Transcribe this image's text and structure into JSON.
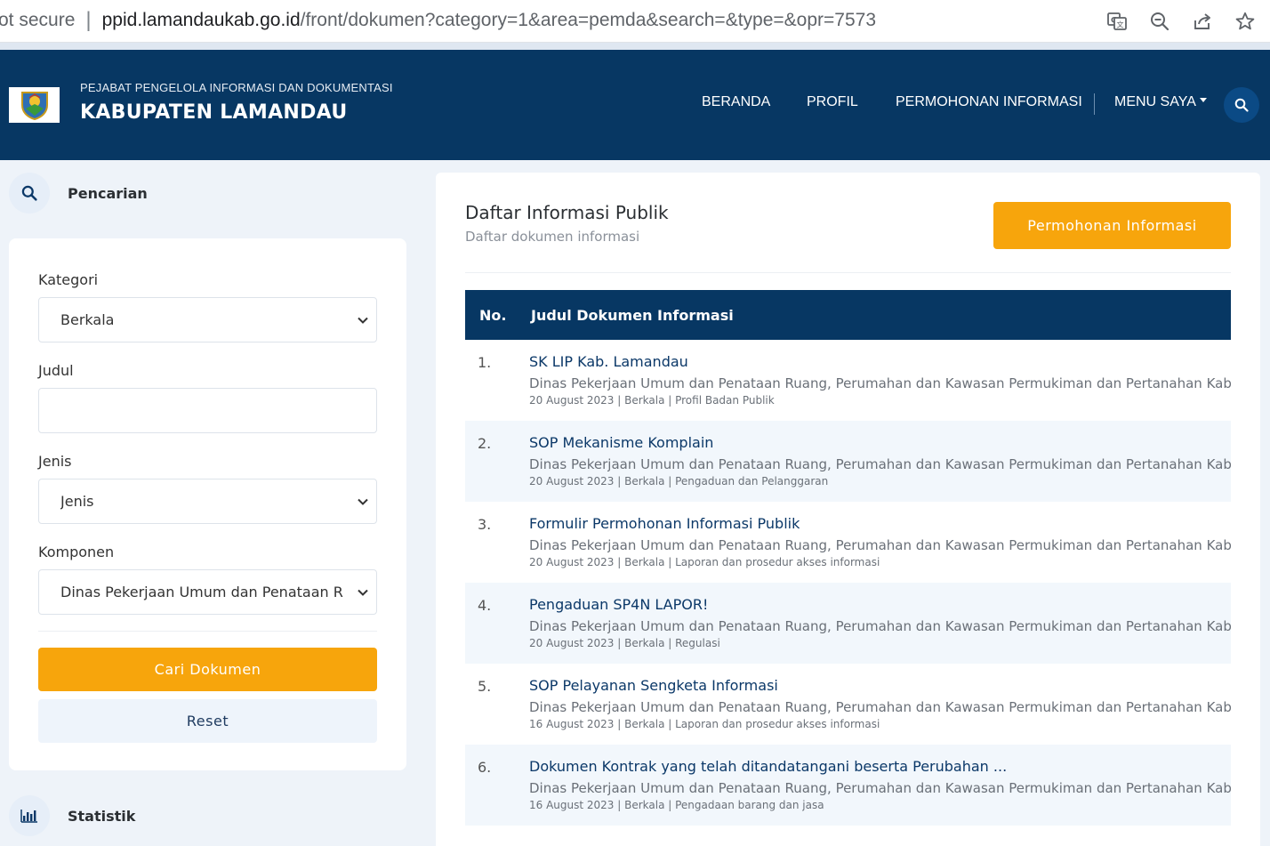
{
  "browser": {
    "security": "ot secure",
    "host": "ppid.lamandaukab.go.id",
    "path": "/front/dokumen?category=1&area=pemda&search=&type=&opr=7573"
  },
  "header": {
    "subtitle": "PEJABAT PENGELOLA INFORMASI DAN DOKUMENTASI",
    "title": "KABUPATEN LAMANDAU",
    "nav": {
      "beranda": "BERANDA",
      "profil": "PROFIL",
      "permohonan": "PERMOHONAN INFORMASI",
      "menu_saya": "MENU SAYA"
    }
  },
  "sidebar": {
    "search_heading": "Pencarian",
    "kategori_label": "Kategori",
    "kategori_value": "Berkala",
    "judul_label": "Judul",
    "judul_value": "",
    "jenis_label": "Jenis",
    "jenis_value": "Jenis",
    "komponen_label": "Komponen",
    "komponen_value": "Dinas Pekerjaan Umum dan Penataan Ruang",
    "cari_button": "Cari Dokumen",
    "reset_button": "Reset",
    "stats_heading": "Statistik"
  },
  "main": {
    "title": "Daftar Informasi Publik",
    "subtitle": "Daftar dokumen informasi",
    "permohonan_button": "Permohonan Informasi",
    "table": {
      "col_no": "No.",
      "col_title": "Judul Dokumen Informasi",
      "rows": [
        {
          "no": "1.",
          "title": "SK LIP Kab. Lamandau",
          "unit": "Dinas Pekerjaan Umum dan Penataan Ruang, Perumahan dan Kawasan Permukiman dan Pertanahan Kabupaten La",
          "meta": "20 August 2023 | Berkala | Profil Badan Publik"
        },
        {
          "no": "2.",
          "title": "SOP Mekanisme Komplain",
          "unit": "Dinas Pekerjaan Umum dan Penataan Ruang, Perumahan dan Kawasan Permukiman dan Pertanahan Kabupaten La",
          "meta": "20 August 2023 | Berkala | Pengaduan dan Pelanggaran"
        },
        {
          "no": "3.",
          "title": "Formulir Permohonan Informasi Publik",
          "unit": "Dinas Pekerjaan Umum dan Penataan Ruang, Perumahan dan Kawasan Permukiman dan Pertanahan Kabupaten La",
          "meta": "20 August 2023 | Berkala | Laporan dan prosedur akses informasi"
        },
        {
          "no": "4.",
          "title": "Pengaduan SP4N LAPOR!",
          "unit": "Dinas Pekerjaan Umum dan Penataan Ruang, Perumahan dan Kawasan Permukiman dan Pertanahan Kabupaten La",
          "meta": "20 August 2023 | Berkala | Regulasi"
        },
        {
          "no": "5.",
          "title": "SOP Pelayanan Sengketa Informasi",
          "unit": "Dinas Pekerjaan Umum dan Penataan Ruang, Perumahan dan Kawasan Permukiman dan Pertanahan Kabupaten La",
          "meta": "16 August 2023 | Berkala | Laporan dan prosedur akses informasi"
        },
        {
          "no": "6.",
          "title": "Dokumen Kontrak yang telah ditandatangani beserta Perubahan ...",
          "unit": "Dinas Pekerjaan Umum dan Penataan Ruang, Perumahan dan Kawasan Permukiman dan Pertanahan Kabupaten La",
          "meta": "16 August 2023 | Berkala | Pengadaan barang dan jasa"
        }
      ]
    }
  },
  "colors": {
    "navy": "#073763",
    "accent": "#f7a50c",
    "link": "#0b3868"
  }
}
